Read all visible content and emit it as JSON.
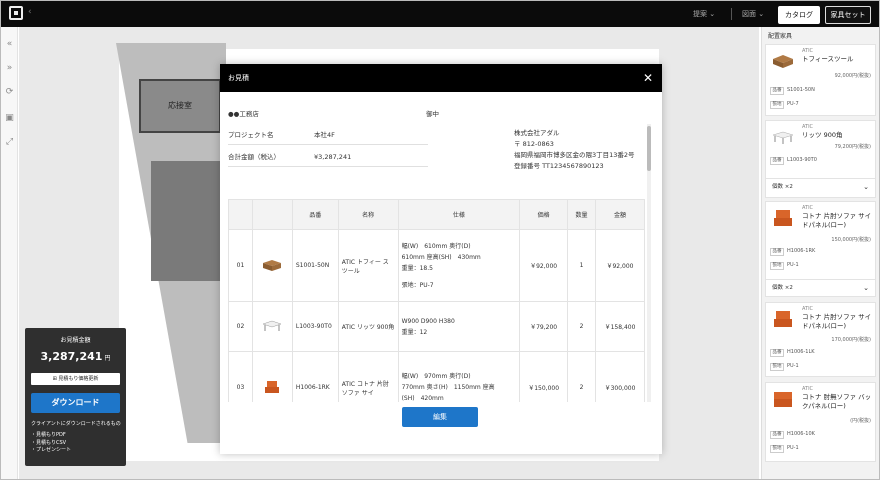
{
  "topbar": {
    "nav": [
      "提案",
      "図面"
    ],
    "catalog_label": "カタログ",
    "furniture_set_label": "家具セット"
  },
  "canvas": {
    "room_label": "応接室"
  },
  "estimate_panel": {
    "title": "お見積金額",
    "amount": "3,287,241",
    "unit": "円",
    "update_label": "見積もり価格更新",
    "download_label": "ダウンロード",
    "note": "クライアントにダウンロードされるもの",
    "items": [
      "・見積もりPDF",
      "・見積もりCSV",
      "・プレゼンシート"
    ]
  },
  "sidebar": {
    "title": "配置家具",
    "cards": [
      {
        "brand": "ATIC",
        "name": "トフィースツール",
        "price": "92,000円(税抜)",
        "code_label": "品番",
        "code": "S1001-50N",
        "spec_label": "張地",
        "spec": "PU-7"
      },
      {
        "brand": "ATIC",
        "name": "リッツ 900角",
        "price": "79,200円(税抜)",
        "code_label": "品番",
        "code": "L1003-90T0",
        "qty": "個数 ×2"
      },
      {
        "brand": "ATIC",
        "name": "コトナ 片肘ソファ サイドパネル(ロー)",
        "price": "150,000円(税抜)",
        "code_label": "品番",
        "code": "H1006-1RK",
        "spec_label": "張地",
        "spec": "PU-1",
        "qty": "個数 ×2"
      },
      {
        "brand": "ATIC",
        "name": "コトナ 片肘ソファ サイドパネル(ロー)",
        "price": "170,000円(税抜)",
        "code_label": "品番",
        "code": "H1006-1LK",
        "spec_label": "張地",
        "spec": "PU-1"
      },
      {
        "brand": "ATIC",
        "name": "コトナ 肘無ソファ バックパネル(ロー)",
        "price": "(円(税抜)",
        "code_label": "品番",
        "code": "H1006-10K",
        "spec_label": "張地",
        "spec": "PU-1"
      }
    ]
  },
  "modal": {
    "title": "お見積",
    "client": "●●工務店",
    "honorific": "御中",
    "project_label": "プロジェクト名",
    "project_value": "本社4F",
    "total_label": "合計金額（税込）",
    "total_value": "¥3,287,241",
    "company": "株式会社アダル",
    "postal": "〒 812-0863",
    "address": "福岡県福岡市博多区金の隈3丁目13番2号",
    "registration": "登録番号 TT1234567890123",
    "columns": [
      "品番",
      "名称",
      "仕様",
      "価格",
      "数量",
      "金額"
    ],
    "rows": [
      {
        "no": "01",
        "code": "S1001-50N",
        "name": "ATIC トフィー スツール",
        "spec": [
          "幅(W)　610mm 奥行(D)",
          "610mm 座高(SH)　430mm",
          "重量：18.5",
          "",
          "張地：PU-7"
        ],
        "price": "￥92,000",
        "qty": "1",
        "amount": "￥92,000"
      },
      {
        "no": "02",
        "code": "L1003-90T0",
        "name": "ATIC リッツ 900角",
        "spec": [
          "W900 D900 H380",
          "重量：12"
        ],
        "price": "￥79,200",
        "qty": "2",
        "amount": "￥158,400"
      },
      {
        "no": "03",
        "code": "H1006-1RK",
        "name": "ATIC コトナ 片肘 ソファ サイ",
        "spec": [
          "幅(W)　970mm 奥行(D)",
          "770mm 奥さ(H)　1150mm 座高",
          "(SH)　420mm"
        ],
        "price": "￥150,000",
        "qty": "2",
        "amount": "￥300,000"
      }
    ],
    "edit_label": "編集"
  },
  "colors": {
    "accent": "#1e76c9",
    "topbar": "#0b0b0b",
    "orange": "#d9652a"
  }
}
